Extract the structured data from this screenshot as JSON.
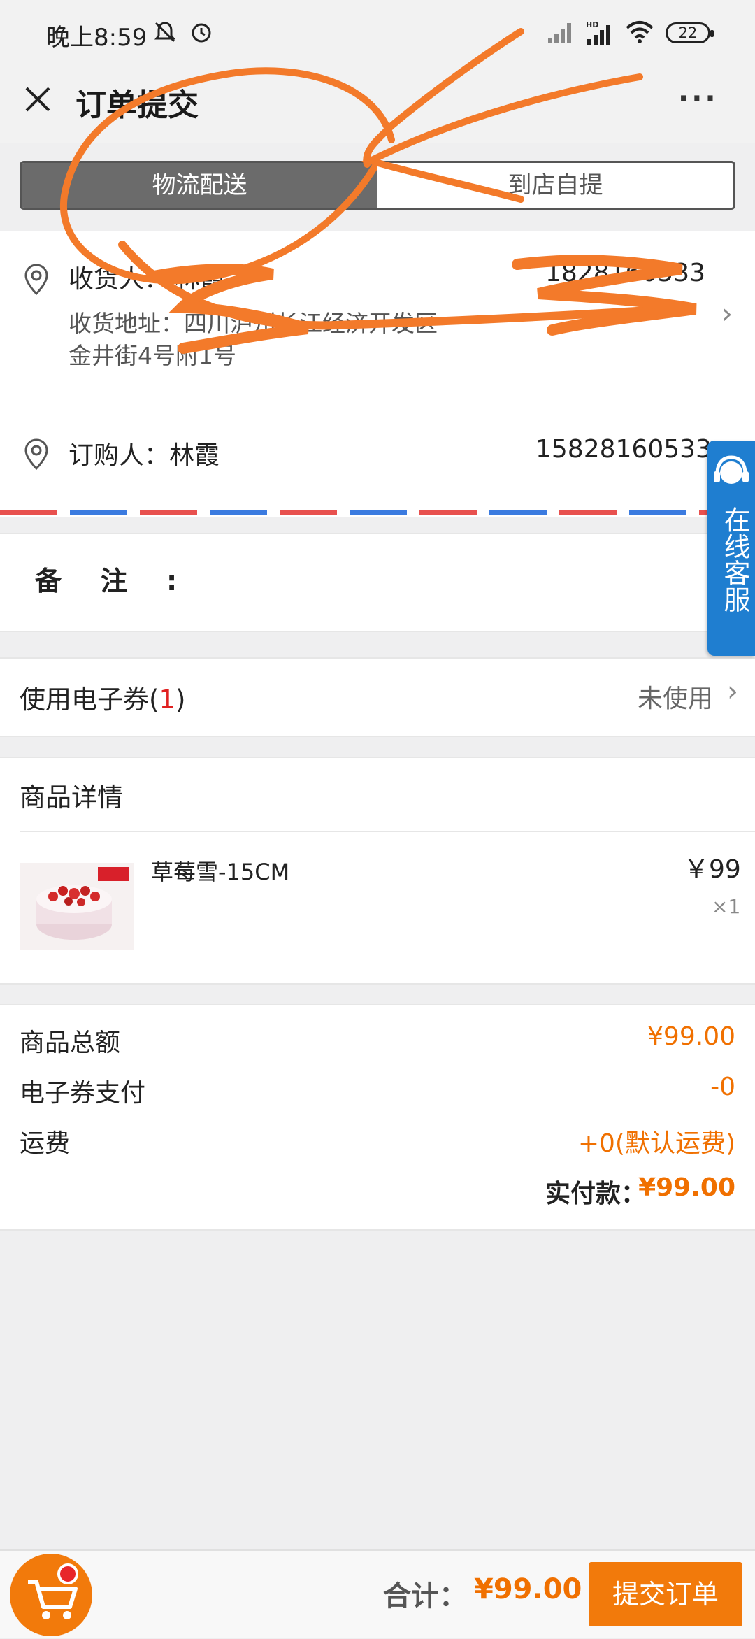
{
  "status_bar": {
    "time": "晚上8:59",
    "battery": "22",
    "icons": [
      "mute-icon",
      "alarm-icon",
      "signal-icon",
      "hd-signal-icon",
      "wifi-icon",
      "battery-icon"
    ]
  },
  "header": {
    "title": "订单提交",
    "close_icon": "close-icon",
    "more_label": "···"
  },
  "delivery_tabs": [
    {
      "label": "物流配送",
      "active": true
    },
    {
      "label": "到店自提",
      "active": false
    }
  ],
  "consignee": {
    "label": "收货人：",
    "name": "林霞",
    "phone": "1828160533",
    "address_label": "收货地址：",
    "address_line1": "四川泸州长江经济开发区",
    "address_line2": "金井街4号附1号"
  },
  "buyer": {
    "label": "订购人：",
    "name": "林霞",
    "phone": "15828160533"
  },
  "remark": {
    "label": "备注:"
  },
  "coupon": {
    "label": "使用电子券(",
    "count": "1",
    "label_end": ")",
    "status": "未使用"
  },
  "product_detail": {
    "title": "商品详情",
    "items": [
      {
        "name": "草莓雪-15CM",
        "price": "￥99",
        "qty": "×1"
      }
    ]
  },
  "summary": {
    "subtotal_label": "商品总额",
    "subtotal_value": "¥99.00",
    "coupon_label": "电子券支付",
    "coupon_value": "-0",
    "shipping_label": "运费",
    "shipping_value": "+0(默认运费)",
    "paid_label": "实付款：",
    "paid_value": "¥99.00"
  },
  "service": {
    "label": "在线客服"
  },
  "bottom_bar": {
    "total_label": "合计：",
    "total_value": "¥99.00",
    "submit_label": "提交订单"
  },
  "colors": {
    "accent": "#f27a0b",
    "price": "#f07000",
    "service": "#1f7ed0",
    "tab_active": "#6b6b6b",
    "scribble": "#f37a2a"
  }
}
